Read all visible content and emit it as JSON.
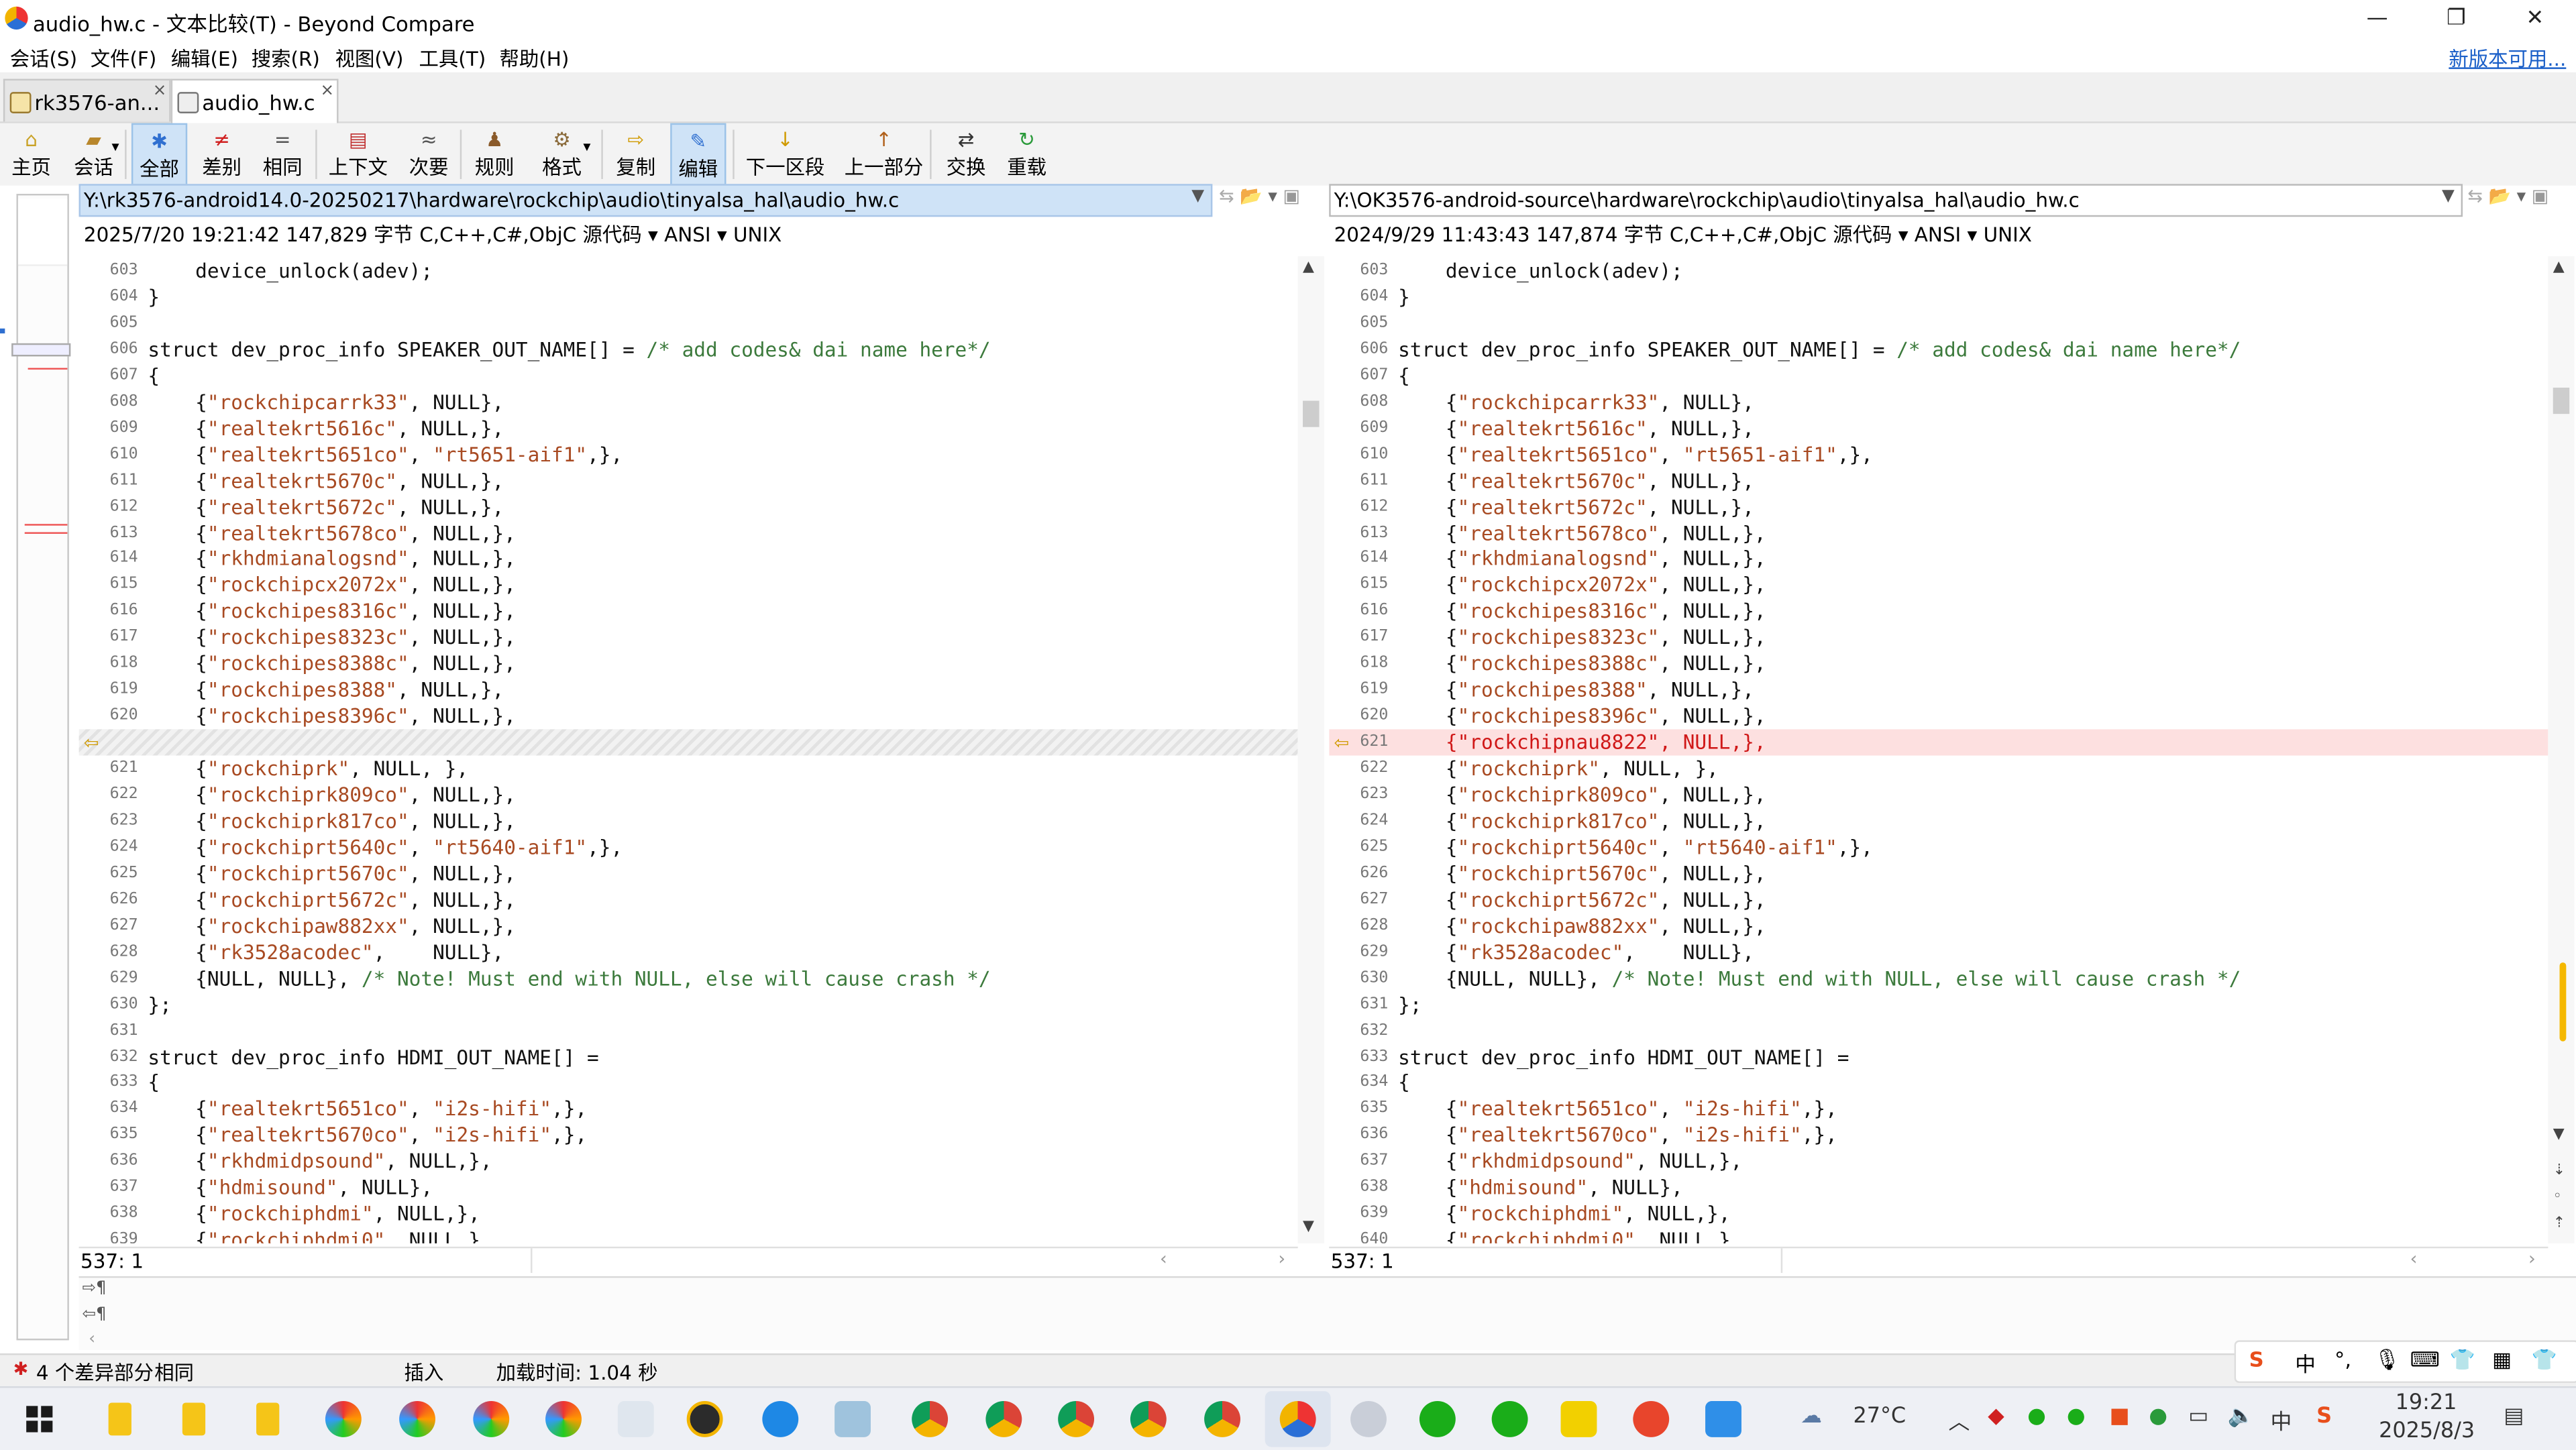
{
  "window": {
    "title": "audio_hw.c - 文本比较(T) - Beyond Compare",
    "minimize": "—",
    "restore": "❐",
    "close": "✕"
  },
  "menu": {
    "items": [
      "会话(S)",
      "文件(F)",
      "编辑(E)",
      "搜索(R)",
      "视图(V)",
      "工具(T)",
      "帮助(H)"
    ],
    "update_link": "新版本可用..."
  },
  "tabs": [
    {
      "label": "rk3576-an...",
      "close": "×"
    },
    {
      "label": "audio_hw.c",
      "close": "×"
    }
  ],
  "toolbar": {
    "buttons": [
      {
        "label": "主页",
        "icon": "home-icon",
        "glyph": "⌂",
        "color": "#c9a227"
      },
      {
        "label": "会话",
        "icon": "session-icon",
        "glyph": "▰",
        "color": "#b8862b"
      },
      {
        "label": "全部",
        "icon": "all-icon",
        "glyph": "✱",
        "color": "#2f6fd0"
      },
      {
        "label": "差别",
        "icon": "diffs-icon",
        "glyph": "≠",
        "color": "#d02020"
      },
      {
        "label": "相同",
        "icon": "same-icon",
        "glyph": "=",
        "color": "#555555"
      },
      {
        "label": "上下文",
        "icon": "context-icon",
        "glyph": "▤",
        "color": "#c03030"
      },
      {
        "label": "次要",
        "icon": "minor-icon",
        "glyph": "≈",
        "color": "#555555"
      },
      {
        "label": "规则",
        "icon": "rules-icon",
        "glyph": "♟",
        "color": "#8a5a2a"
      },
      {
        "label": "格式",
        "icon": "format-icon",
        "glyph": "⚙",
        "color": "#8a6a3a"
      },
      {
        "label": "复制",
        "icon": "copy-icon",
        "glyph": "⇨",
        "color": "#d09a00"
      },
      {
        "label": "编辑",
        "icon": "edit-icon",
        "glyph": "✎",
        "color": "#2f6fd0"
      },
      {
        "label": "下一区段",
        "icon": "next-section-icon",
        "glyph": "↓",
        "color": "#d09a00"
      },
      {
        "label": "上一部分",
        "icon": "prev-section-icon",
        "glyph": "↑",
        "color": "#b0601a"
      },
      {
        "label": "交换",
        "icon": "swap-icon",
        "glyph": "⇄",
        "color": "#333333"
      },
      {
        "label": "重载",
        "icon": "reload-icon",
        "glyph": "↻",
        "color": "#2a9a3a"
      }
    ]
  },
  "left": {
    "path": "Y:\\rk3576-android14.0-20250217\\hardware\\rockchip\\audio\\tinyalsa_hal\\audio_hw.c",
    "info": "2025/7/20 19:21:42  147,829 字节  C,C++,C#,ObjC 源代码 ▾ ANSI ▾ UNIX",
    "cursor": "537: 1",
    "lines": [
      {
        "n": "603",
        "t": "    device_unlock(adev);"
      },
      {
        "n": "604",
        "t": "}"
      },
      {
        "n": "605",
        "t": ""
      },
      {
        "n": "606",
        "t": "struct dev_proc_info SPEAKER_OUT_NAME[] = /* add codes& dai name here*/"
      },
      {
        "n": "607",
        "t": "{"
      },
      {
        "n": "608",
        "t": "    {\"rockchipcarrk33\", NULL},"
      },
      {
        "n": "609",
        "t": "    {\"realtekrt5616c\", NULL,},"
      },
      {
        "n": "610",
        "t": "    {\"realtekrt5651co\", \"rt5651-aif1\",},"
      },
      {
        "n": "611",
        "t": "    {\"realtekrt5670c\", NULL,},"
      },
      {
        "n": "612",
        "t": "    {\"realtekrt5672c\", NULL,},"
      },
      {
        "n": "613",
        "t": "    {\"realtekrt5678co\", NULL,},"
      },
      {
        "n": "614",
        "t": "    {\"rkhdmianalogsnd\", NULL,},"
      },
      {
        "n": "615",
        "t": "    {\"rockchipcx2072x\", NULL,},"
      },
      {
        "n": "616",
        "t": "    {\"rockchipes8316c\", NULL,},"
      },
      {
        "n": "617",
        "t": "    {\"rockchipes8323c\", NULL,},"
      },
      {
        "n": "618",
        "t": "    {\"rockchipes8388c\", NULL,},"
      },
      {
        "n": "619",
        "t": "    {\"rockchipes8388\", NULL,},"
      },
      {
        "n": "620",
        "t": "    {\"rockchipes8396c\", NULL,},"
      },
      {
        "n": "",
        "t": "",
        "kind": "gap"
      },
      {
        "n": "621",
        "t": "    {\"rockchiprk\", NULL, },"
      },
      {
        "n": "622",
        "t": "    {\"rockchiprk809co\", NULL,},"
      },
      {
        "n": "623",
        "t": "    {\"rockchiprk817co\", NULL,},"
      },
      {
        "n": "624",
        "t": "    {\"rockchiprt5640c\", \"rt5640-aif1\",},"
      },
      {
        "n": "625",
        "t": "    {\"rockchiprt5670c\", NULL,},"
      },
      {
        "n": "626",
        "t": "    {\"rockchiprt5672c\", NULL,},"
      },
      {
        "n": "627",
        "t": "    {\"rockchipaw882xx\", NULL,},"
      },
      {
        "n": "628",
        "t": "    {\"rk3528acodec\",    NULL},"
      },
      {
        "n": "629",
        "t": "    {NULL, NULL}, /* Note! Must end with NULL, else will cause crash */"
      },
      {
        "n": "630",
        "t": "};"
      },
      {
        "n": "631",
        "t": ""
      },
      {
        "n": "632",
        "t": "struct dev_proc_info HDMI_OUT_NAME[] ="
      },
      {
        "n": "633",
        "t": "{"
      },
      {
        "n": "634",
        "t": "    {\"realtekrt5651co\", \"i2s-hifi\",},"
      },
      {
        "n": "635",
        "t": "    {\"realtekrt5670co\", \"i2s-hifi\",},"
      },
      {
        "n": "636",
        "t": "    {\"rkhdmidpsound\", NULL,},"
      },
      {
        "n": "637",
        "t": "    {\"hdmisound\", NULL},"
      },
      {
        "n": "638",
        "t": "    {\"rockchiphdmi\", NULL,},"
      },
      {
        "n": "639",
        "t": "    {\"rockchiphdmi0\", NULL,},"
      }
    ]
  },
  "right": {
    "path": "Y:\\OK3576-android-source\\hardware\\rockchip\\audio\\tinyalsa_hal\\audio_hw.c",
    "info": "2024/9/29 11:43:43  147,874 字节  C,C++,C#,ObjC 源代码 ▾ ANSI ▾ UNIX",
    "cursor": "537: 1",
    "lines": [
      {
        "n": "603",
        "t": "    device_unlock(adev);"
      },
      {
        "n": "604",
        "t": "}"
      },
      {
        "n": "605",
        "t": ""
      },
      {
        "n": "606",
        "t": "struct dev_proc_info SPEAKER_OUT_NAME[] = /* add codes& dai name here*/"
      },
      {
        "n": "607",
        "t": "{"
      },
      {
        "n": "608",
        "t": "    {\"rockchipcarrk33\", NULL},"
      },
      {
        "n": "609",
        "t": "    {\"realtekrt5616c\", NULL,},"
      },
      {
        "n": "610",
        "t": "    {\"realtekrt5651co\", \"rt5651-aif1\",},"
      },
      {
        "n": "611",
        "t": "    {\"realtekrt5670c\", NULL,},"
      },
      {
        "n": "612",
        "t": "    {\"realtekrt5672c\", NULL,},"
      },
      {
        "n": "613",
        "t": "    {\"realtekrt5678co\", NULL,},"
      },
      {
        "n": "614",
        "t": "    {\"rkhdmianalogsnd\", NULL,},"
      },
      {
        "n": "615",
        "t": "    {\"rockchipcx2072x\", NULL,},"
      },
      {
        "n": "616",
        "t": "    {\"rockchipes8316c\", NULL,},"
      },
      {
        "n": "617",
        "t": "    {\"rockchipes8323c\", NULL,},"
      },
      {
        "n": "618",
        "t": "    {\"rockchipes8388c\", NULL,},"
      },
      {
        "n": "619",
        "t": "    {\"rockchipes8388\", NULL,},"
      },
      {
        "n": "620",
        "t": "    {\"rockchipes8396c\", NULL,},"
      },
      {
        "n": "621",
        "t": "    {\"rockchipnau8822\", NULL,},",
        "kind": "diff"
      },
      {
        "n": "622",
        "t": "    {\"rockchiprk\", NULL, },"
      },
      {
        "n": "623",
        "t": "    {\"rockchiprk809co\", NULL,},"
      },
      {
        "n": "624",
        "t": "    {\"rockchiprk817co\", NULL,},"
      },
      {
        "n": "625",
        "t": "    {\"rockchiprt5640c\", \"rt5640-aif1\",},"
      },
      {
        "n": "626",
        "t": "    {\"rockchiprt5670c\", NULL,},"
      },
      {
        "n": "627",
        "t": "    {\"rockchiprt5672c\", NULL,},"
      },
      {
        "n": "628",
        "t": "    {\"rockchipaw882xx\", NULL,},"
      },
      {
        "n": "629",
        "t": "    {\"rk3528acodec\",    NULL},"
      },
      {
        "n": "630",
        "t": "    {NULL, NULL}, /* Note! Must end with NULL, else will cause crash */"
      },
      {
        "n": "631",
        "t": "};"
      },
      {
        "n": "632",
        "t": ""
      },
      {
        "n": "633",
        "t": "struct dev_proc_info HDMI_OUT_NAME[] ="
      },
      {
        "n": "634",
        "t": "{"
      },
      {
        "n": "635",
        "t": "    {\"realtekrt5651co\", \"i2s-hifi\",},"
      },
      {
        "n": "636",
        "t": "    {\"realtekrt5670co\", \"i2s-hifi\",},"
      },
      {
        "n": "637",
        "t": "    {\"rkhdmidpsound\", NULL,},"
      },
      {
        "n": "638",
        "t": "    {\"hdmisound\", NULL},"
      },
      {
        "n": "639",
        "t": "    {\"rockchiphdmi\", NULL,},"
      },
      {
        "n": "640",
        "t": "    {\"rockchiphdmi0\", NULL,},"
      }
    ]
  },
  "status": {
    "diff_count": "4 个差异部分",
    "same_text": "相同",
    "mode": "插入",
    "load_time": "加载时间: 1.04 秒"
  },
  "ime": {
    "lang": "中"
  },
  "taskbar": {
    "weather": "27°C",
    "time": "19:21",
    "date": "2025/8/3",
    "tray_lang": "中"
  },
  "colors": {
    "diff_bg": "#fde0e0",
    "diff_text": "#d01818",
    "accent": "#2f6fd0"
  }
}
